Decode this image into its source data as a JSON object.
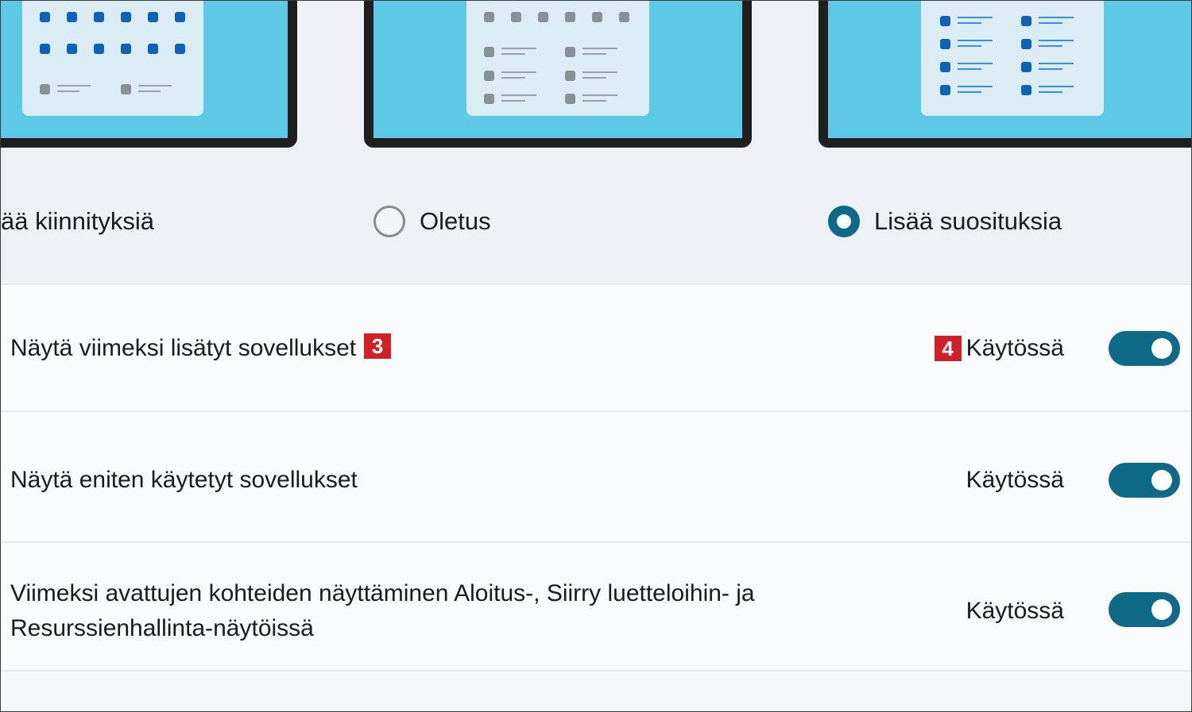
{
  "layout_options": [
    {
      "label": "ää kiinnityksiä",
      "selected": false
    },
    {
      "label": "Oletus",
      "selected": false
    },
    {
      "label": "Lisää suosituksia",
      "selected": true
    }
  ],
  "settings": [
    {
      "label": "Näytä viimeksi lisätyt sovellukset",
      "label_badge": "3",
      "state_badge": "4",
      "state": "Käytössä",
      "enabled": true
    },
    {
      "label": "Näytä eniten käytetyt sovellukset",
      "state": "Käytössä",
      "enabled": true
    },
    {
      "label_line1": "Viimeksi avattujen kohteiden näyttäminen Aloitus-, Siirry luetteloihin- ja",
      "label_line2": "Resurssienhallinta-näytöissä",
      "state": "Käytössä",
      "enabled": true
    }
  ],
  "colors": {
    "accent": "#0e6a86",
    "badge": "#d0202a",
    "screen": "#5ec9e6",
    "icon_blue": "#0d63b8"
  }
}
